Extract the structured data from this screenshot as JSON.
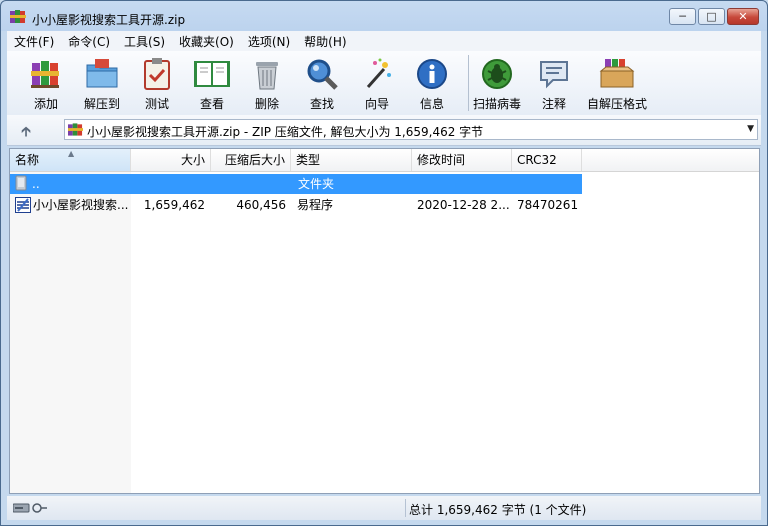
{
  "window": {
    "title": "小小屋影视搜索工具开源.zip"
  },
  "menu": [
    {
      "label": "文件(F)"
    },
    {
      "label": "命令(C)"
    },
    {
      "label": "工具(S)"
    },
    {
      "label": "收藏夹(O)"
    },
    {
      "label": "选项(N)"
    },
    {
      "label": "帮助(H)"
    }
  ],
  "toolbar": {
    "buttons": [
      {
        "label": "添加",
        "icon": "books-add-icon"
      },
      {
        "label": "解压到",
        "icon": "folder-extract-icon"
      },
      {
        "label": "测试",
        "icon": "clipboard-check-icon"
      },
      {
        "label": "查看",
        "icon": "open-book-icon"
      },
      {
        "label": "删除",
        "icon": "trash-can-icon"
      },
      {
        "label": "查找",
        "icon": "magnifier-icon"
      },
      {
        "label": "向导",
        "icon": "magic-wand-icon"
      },
      {
        "label": "信息",
        "icon": "info-icon"
      },
      {
        "label": "扫描病毒",
        "icon": "virus-scan-icon"
      },
      {
        "label": "注释",
        "icon": "comment-icon"
      },
      {
        "label": "自解压格式",
        "icon": "sfx-box-icon"
      }
    ]
  },
  "address": {
    "path": "小小屋影视搜索工具开源.zip - ZIP 压缩文件, 解包大小为 1,659,462 字节"
  },
  "columns": [
    "名称",
    "大小",
    "压缩后大小",
    "类型",
    "修改时间",
    "CRC32"
  ],
  "rows": [
    {
      "name": "..",
      "size": "",
      "packed": "",
      "type": "文件夹",
      "modified": "",
      "crc": "",
      "selected": true
    },
    {
      "name": "小小屋影视搜索...",
      "size": "1,659,462",
      "packed": "460,456",
      "type": "易程序",
      "modified": "2020-12-28 2...",
      "crc": "78470261",
      "selected": false
    }
  ],
  "status": {
    "summary": "总计 1,659,462 字节 (1 个文件)"
  },
  "colors": {
    "selection": "#3399ff",
    "title_bg": "#c6daf1",
    "close_button": "#c7483a"
  }
}
